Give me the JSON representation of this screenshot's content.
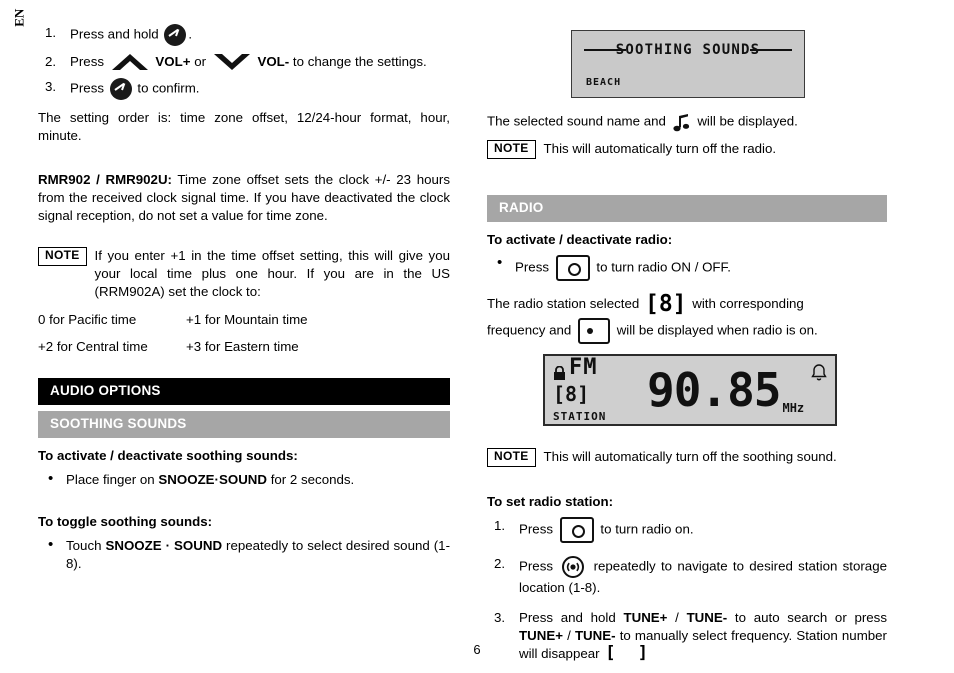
{
  "spine_label": "EN",
  "page_number": "6",
  "left": {
    "steps": [
      {
        "num": "1.",
        "text_before": "Press and hold",
        "icon": "clock-confirm-icon",
        "text_after": "."
      },
      {
        "num": "2.",
        "text_before": "Press",
        "icon_up": "chevron-up-icon",
        "label_up": "VOL+",
        "mid": "or",
        "icon_down": "chevron-down-icon",
        "label_down": "VOL-",
        "text_after": "to change the settings."
      },
      {
        "num": "3.",
        "text_before": "Press",
        "icon": "clock-confirm-icon",
        "text_after": "to confirm."
      }
    ],
    "order_paragraph": "The setting order is: time zone offset, 12/24-hour format, hour, minute.",
    "model_paragraph_bold": "RMR902 / RMR902U:",
    "model_paragraph": " Time zone offset sets the clock +/- 23 hours from the received clock signal time.  If you have deactivated the clock signal reception, do not set a value for time zone.",
    "note1_badge": "NOTE",
    "note1_text": "If you enter +1 in the time offset setting, this will give you your local time plus one hour.  If you are in the US (RRM902A) set the clock to:",
    "timezones": [
      {
        "a": "0 for Pacific time",
        "b": "+1 for Mountain time"
      },
      {
        "a": "+2 for Central time",
        "b": "+3 for Eastern time"
      }
    ],
    "bar_audio_options": "AUDIO OPTIONS",
    "bar_soothing_sounds": "SOOTHING SOUNDS",
    "activate_head": "To activate / deactivate soothing sounds:",
    "activate_bullet_before": "Place finger on ",
    "activate_bullet_bold": "SNOOZE·SOUND",
    "activate_bullet_after": " for 2 seconds.",
    "toggle_head": "To toggle soothing sounds:",
    "toggle_bullet_before": "Touch ",
    "toggle_bullet_bold": "SNOOZE · SOUND",
    "toggle_bullet_after": " repeatedly to select desired sound (1-8)."
  },
  "right": {
    "lcd_sound": {
      "title": "SOOTHING SOUNDS",
      "sub": "BEACH"
    },
    "sound_line_before": "The selected sound name and",
    "sound_line_icon": "music-note-icon",
    "sound_line_after": "will be displayed.",
    "note_radio_off_badge": "NOTE",
    "note_radio_off_text": "This will automatically turn off the radio.",
    "bar_radio": "RADIO",
    "activate_radio_head": "To activate / deactivate radio:",
    "activate_radio_bullet_before": "Press",
    "activate_radio_bullet_icon": "radio-power-icon",
    "activate_radio_bullet_after": "to turn radio ON / OFF.",
    "station_line_1_before": "The  radio  station  selected",
    "station_line_1_bracket": "[8]",
    "station_line_1_after": "with  corresponding",
    "station_line_2_before": "frequency and",
    "station_line_2_icon": "station-indicator-icon",
    "station_line_2_after": "will be displayed when radio is on.",
    "lcd_radio": {
      "lock_icon": "lock-icon",
      "fm_label": "FM",
      "station_number": "[8]",
      "station_label": "STATION",
      "frequency": "90.85",
      "unit": "MHz",
      "alarm_icon": "bell-icon"
    },
    "note_sound_off_badge": "NOTE",
    "note_sound_off_text": "This will automatically turn off the soothing sound.",
    "set_station_head": "To set radio station:",
    "steps": [
      {
        "num": "1.",
        "before": "Press",
        "icon": "radio-power-icon",
        "after": "to turn radio on."
      },
      {
        "num": "2.",
        "before": "Press",
        "icon": "station-scan-icon",
        "after": "repeatedly  to  navigate  to  desired  station storage location (1-8)."
      },
      {
        "num": "3.",
        "before": "Press and hold ",
        "bold1": "TUNE+",
        "mid1": " / ",
        "bold2": "TUNE-",
        "after1": " to auto search or press ",
        "bold3": "TUNE+",
        "mid2": " / ",
        "bold4": "TUNE-",
        "after2": " to manually select frequency.  Station number will disappear",
        "bracket": "[    ]"
      }
    ]
  }
}
